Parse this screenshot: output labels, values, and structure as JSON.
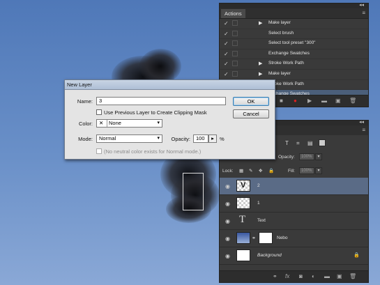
{
  "actions_panel": {
    "collapse_glyph": "◂◂",
    "tab_label": "Actions",
    "menu_glyph": "≡",
    "rows": [
      {
        "label": "Make layer",
        "expandable": true,
        "highlight": false
      },
      {
        "label": "Select brush",
        "expandable": false,
        "highlight": false
      },
      {
        "label": "Select tool preset \"300\"",
        "expandable": false,
        "highlight": false
      },
      {
        "label": "Exchange Swatches",
        "expandable": false,
        "highlight": false
      },
      {
        "label": "Stroke Work Path",
        "expandable": true,
        "highlight": false
      },
      {
        "label": "Make layer",
        "expandable": true,
        "highlight": false
      },
      {
        "label": "Stroke Work Path",
        "expandable": true,
        "highlight": false
      },
      {
        "label": "Exchange Swatches",
        "expandable": false,
        "highlight": true
      }
    ],
    "check_glyph": "✓",
    "expand_glyph": "▶"
  },
  "layers_panel": {
    "collapse_glyph": "◂◂",
    "menu_glyph": "≡",
    "opacity_label": "Opacity:",
    "opacity_value": "100%",
    "lock_label": "Lock:",
    "fill_label": "Fill:",
    "fill_value": "100%",
    "layers": [
      {
        "name": "2",
        "thumb": "checker",
        "glyph": "V",
        "active": true,
        "italic": false
      },
      {
        "name": "1",
        "thumb": "checker",
        "glyph": "",
        "active": false,
        "italic": false
      },
      {
        "name": "Text",
        "thumb": "type",
        "glyph": "T",
        "active": false,
        "italic": false
      },
      {
        "name": "Nebo",
        "thumb": "grad",
        "glyph": "",
        "active": false,
        "italic": false
      },
      {
        "name": "Background",
        "thumb": "white",
        "glyph": "",
        "active": false,
        "italic": true
      }
    ],
    "eye_glyph": "◉",
    "lock_glyph": "🔒"
  },
  "dialog": {
    "title": "New Layer",
    "name_label": "Name:",
    "name_value": "3",
    "clip_label": "Use Previous Layer to Create Clipping Mask",
    "color_label": "Color:",
    "color_value": "None",
    "color_x": "✕",
    "mode_label": "Mode:",
    "mode_value": "Normal",
    "opacity_label": "Opacity:",
    "opacity_value": "100",
    "opacity_unit": "%",
    "neutral_label": "(No neutral color exists for Normal mode.)",
    "ok_label": "OK",
    "cancel_label": "Cancel",
    "caret": "▾"
  }
}
